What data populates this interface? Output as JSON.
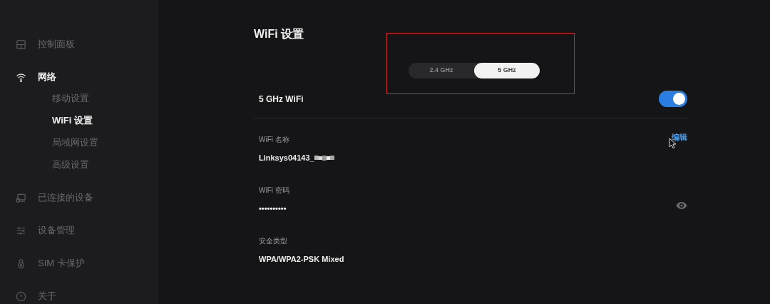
{
  "sidebar": {
    "items": [
      {
        "label": "控制面板",
        "kind": "dashboard",
        "selected": false
      },
      {
        "label": "网络",
        "kind": "wifi",
        "selected": true,
        "children": [
          {
            "label": "移动设置",
            "selected": false
          },
          {
            "label": "WiFi 设置",
            "selected": true
          },
          {
            "label": "局域网设置",
            "selected": false
          },
          {
            "label": "高级设置",
            "selected": false
          }
        ]
      },
      {
        "label": "已连接的设备",
        "kind": "devices",
        "selected": false
      },
      {
        "label": "设备管理",
        "kind": "sliders",
        "selected": false
      },
      {
        "label": "SIM 卡保护",
        "kind": "lock",
        "selected": false
      },
      {
        "label": "关于",
        "kind": "info",
        "selected": false
      }
    ]
  },
  "page": {
    "title": "WiFi 设置",
    "bands": [
      {
        "label": "2.4 GHz",
        "selected": false
      },
      {
        "label": "5 GHz",
        "selected": true
      }
    ],
    "toggle": {
      "label": "5 GHz WiFi",
      "on": true
    },
    "fields": [
      {
        "label": "WiFi 名称",
        "value": "Linksys04143_",
        "redacted": true,
        "action": "编辑"
      },
      {
        "label": "WiFi 密码",
        "value": "••••••••••",
        "reveal": true
      },
      {
        "label": "安全类型",
        "value": "WPA/WPA2-PSK Mixed"
      }
    ]
  }
}
